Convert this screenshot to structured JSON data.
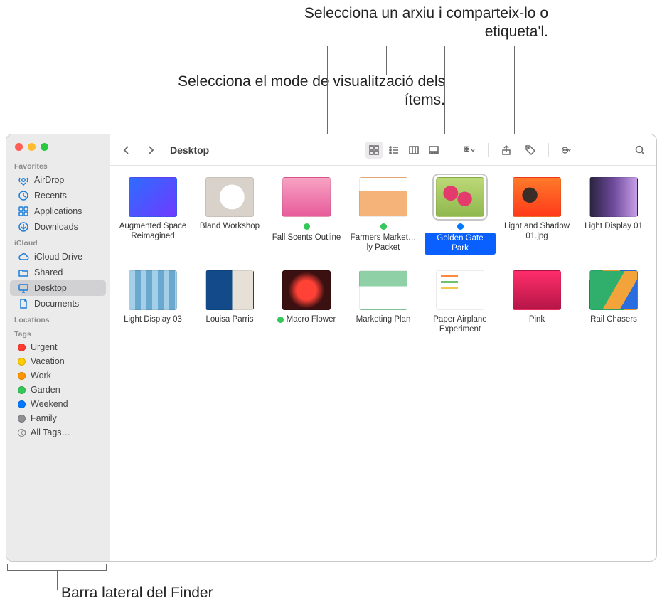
{
  "callouts": {
    "share_tag": "Selecciona un arxiu i comparteix-lo o etiqueta'l.",
    "view_mode": "Selecciona el mode de visualització dels ítems.",
    "sidebar": "Barra lateral del Finder"
  },
  "toolbar": {
    "title": "Desktop"
  },
  "sidebar": {
    "sections": {
      "favorites": "Favorites",
      "icloud": "iCloud",
      "locations": "Locations",
      "tags": "Tags"
    },
    "favorites": [
      {
        "label": "AirDrop",
        "icon": "airdrop"
      },
      {
        "label": "Recents",
        "icon": "clock"
      },
      {
        "label": "Applications",
        "icon": "apps"
      },
      {
        "label": "Downloads",
        "icon": "download"
      }
    ],
    "icloud": [
      {
        "label": "iCloud Drive",
        "icon": "cloud"
      },
      {
        "label": "Shared",
        "icon": "folder-shared"
      },
      {
        "label": "Desktop",
        "icon": "desktop",
        "selected": true
      },
      {
        "label": "Documents",
        "icon": "doc"
      }
    ],
    "tags": [
      {
        "label": "Urgent",
        "color": "#ff3b30"
      },
      {
        "label": "Vacation",
        "color": "#ffcc00"
      },
      {
        "label": "Work",
        "color": "#ff9500"
      },
      {
        "label": "Garden",
        "color": "#34c759"
      },
      {
        "label": "Weekend",
        "color": "#007aff"
      },
      {
        "label": "Family",
        "color": "#8e8e93"
      },
      {
        "label": "All Tags…",
        "all": true
      }
    ]
  },
  "files": [
    {
      "name": "Augmented Space Reimagined",
      "thumb": "th-grad1"
    },
    {
      "name": "Bland Workshop",
      "thumb": "th-plate"
    },
    {
      "name": "Fall Scents Outline",
      "thumb": "th-pink",
      "tag": "#34c759"
    },
    {
      "name": "Farmers Market…ly Packet",
      "thumb": "th-peach",
      "tag": "#34c759"
    },
    {
      "name": "Golden Gate Park",
      "thumb": "th-flowers",
      "tag": "#007aff",
      "selected": true
    },
    {
      "name": "Light and Shadow 01.jpg",
      "thumb": "th-orange"
    },
    {
      "name": "Light Display 01",
      "thumb": "th-light1"
    },
    {
      "name": "Light Display 03",
      "thumb": "th-light3"
    },
    {
      "name": "Louisa Parris",
      "thumb": "th-louisa"
    },
    {
      "name": "Macro Flower",
      "thumb": "th-macro",
      "tag": "#34c759"
    },
    {
      "name": "Marketing Plan",
      "thumb": "th-plan"
    },
    {
      "name": "Paper Airplane Experiment",
      "thumb": "th-paper"
    },
    {
      "name": "Pink",
      "thumb": "th-pinkp"
    },
    {
      "name": "Rail Chasers",
      "thumb": "th-rail"
    }
  ]
}
